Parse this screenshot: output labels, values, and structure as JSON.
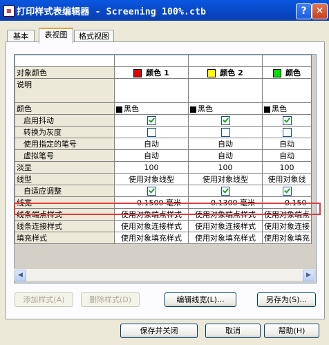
{
  "window": {
    "title": "打印样式表编辑器 - Screening 100%.ctb",
    "help_label": "?",
    "close_label": "✕"
  },
  "tabs": [
    {
      "label": "基本"
    },
    {
      "label": "表视图"
    },
    {
      "label": "格式视图"
    }
  ],
  "grid": {
    "styles": [
      {
        "name": "颜色 1",
        "color": "#e00000",
        "description": "",
        "color_value": "黑色",
        "dither": true,
        "grayscale": false,
        "pen": "自动",
        "virtual_pen": "自动",
        "screening": "100",
        "linetype": "使用对象线型",
        "adaptive": true,
        "lineweight": "0.1500 毫米",
        "line_end": "使用对象端点样式",
        "line_join": "使用对象连接样式",
        "fill": "使用对象填充样式"
      },
      {
        "name": "颜色 2",
        "color": "#ffff00",
        "description": "",
        "color_value": "黑色",
        "dither": true,
        "grayscale": false,
        "pen": "自动",
        "virtual_pen": "自动",
        "screening": "100",
        "linetype": "使用对象线型",
        "adaptive": true,
        "lineweight": "0.1300 毫米",
        "line_end": "使用对象端点样式",
        "line_join": "使用对象连接样式",
        "fill": "使用对象填充样式"
      },
      {
        "name": "颜色",
        "color": "#00e000",
        "description": "",
        "color_value": "黑色",
        "dither": true,
        "grayscale": false,
        "pen": "自动",
        "virtual_pen": "自动",
        "screening": "100",
        "linetype": "使用对象线",
        "adaptive": true,
        "lineweight": "0.150",
        "line_end": "使用对象端点",
        "line_join": "使用对象连接",
        "fill": "使用对象填充"
      }
    ],
    "row_labels": {
      "name": "对象颜色",
      "description": "说明",
      "color": "颜色",
      "dither": "启用抖动",
      "grayscale": "转换为灰度",
      "pen": "使用指定的笔号",
      "virtual_pen": "虚拟笔号",
      "screening": "淡显",
      "linetype": "线型",
      "adaptive": "自适应调整",
      "lineweight": "线宽",
      "line_end": "线条端点样式",
      "line_join": "线条连接样式",
      "fill": "填充样式"
    },
    "selected_row": "lineweight"
  },
  "buttons": {
    "add_style": "添加样式(A)",
    "delete_style": "删除样式(D)",
    "edit_lineweights": "编辑线宽(L)...",
    "save_as": "另存为(S)...",
    "save_close": "保存并关闭",
    "cancel": "取消",
    "help": "帮助(H)"
  },
  "colors": {
    "title_bar": "#0a56e0",
    "highlight": "#e23c3c",
    "check": "#21a121"
  }
}
